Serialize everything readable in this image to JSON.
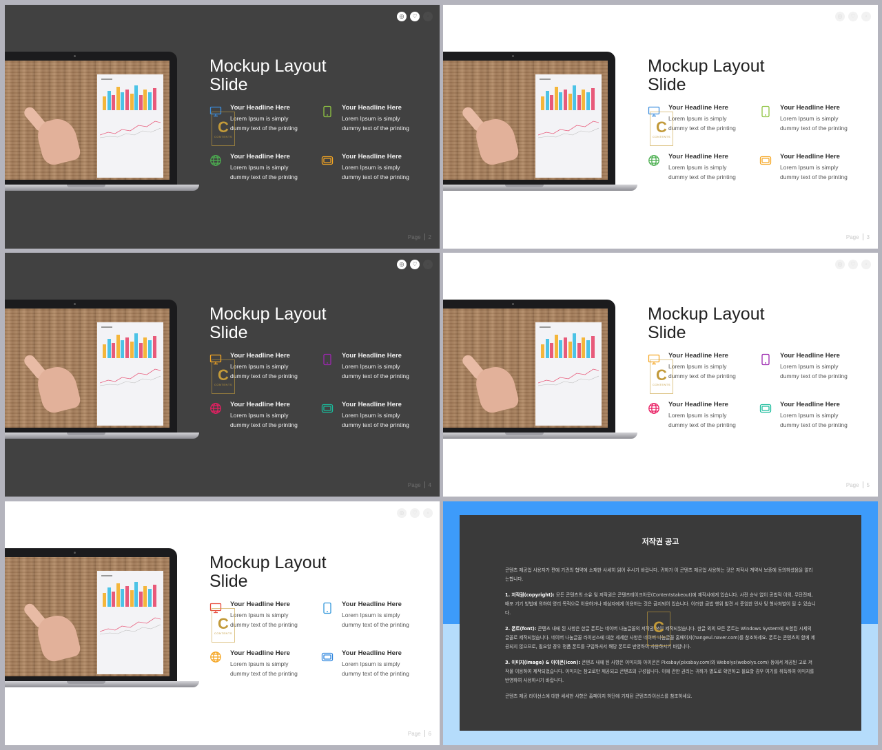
{
  "slides": [
    {
      "id": "2",
      "theme": "dark",
      "page_label": "Page",
      "page_number": "2",
      "title_line1": "Mockup Layout",
      "title_line2": "Slide",
      "icon_colors": [
        "#3c8ede",
        "#8fc442",
        "#4caf50",
        "#f5a623"
      ],
      "features": [
        {
          "headline": "Your Headline Here",
          "line1": "Lorem Ipsum is simply",
          "line2": "dummy text of the printing"
        },
        {
          "headline": "Your Headline Here",
          "line1": "Lorem Ipsum is simply",
          "line2": "dummy text of the printing"
        },
        {
          "headline": "Your Headline Here",
          "line1": "Lorem Ipsum is simply",
          "line2": "dummy text of the printing"
        },
        {
          "headline": "Your Headline Here",
          "line1": "Lorem Ipsum is simply",
          "line2": "dummy text of the printing"
        }
      ]
    },
    {
      "id": "3",
      "theme": "light",
      "page_label": "Page",
      "page_number": "3",
      "title_line1": "Mockup Layout",
      "title_line2": "Slide",
      "icon_colors": [
        "#3c8ede",
        "#8fc442",
        "#4caf50",
        "#f5a623"
      ],
      "features": [
        {
          "headline": "Your Headline Here",
          "line1": "Lorem Ipsum is simply",
          "line2": "dummy text of the printing"
        },
        {
          "headline": "Your Headline Here",
          "line1": "Lorem Ipsum is simply",
          "line2": "dummy text of the printing"
        },
        {
          "headline": "Your Headline Here",
          "line1": "Lorem Ipsum is simply",
          "line2": "dummy text of the printing"
        },
        {
          "headline": "Your Headline Here",
          "line1": "Lorem Ipsum is simply",
          "line2": "dummy text of the printing"
        }
      ]
    },
    {
      "id": "4",
      "theme": "dark",
      "page_label": "Page",
      "page_number": "4",
      "title_line1": "Mockup Layout",
      "title_line2": "Slide",
      "icon_colors": [
        "#f5a623",
        "#9b27af",
        "#e91e63",
        "#1abc9c"
      ],
      "features": [
        {
          "headline": "Your Headline Here",
          "line1": "Lorem Ipsum is simply",
          "line2": "dummy text of the printing"
        },
        {
          "headline": "Your Headline Here",
          "line1": "Lorem Ipsum is simply",
          "line2": "dummy text of the printing"
        },
        {
          "headline": "Your Headline Here",
          "line1": "Lorem Ipsum is simply",
          "line2": "dummy text of the printing"
        },
        {
          "headline": "Your Headline Here",
          "line1": "Lorem Ipsum is simply",
          "line2": "dummy text of the printing"
        }
      ]
    },
    {
      "id": "5",
      "theme": "light",
      "page_label": "Page",
      "page_number": "5",
      "title_line1": "Mockup Layout",
      "title_line2": "Slide",
      "icon_colors": [
        "#f5a623",
        "#9b27af",
        "#e91e63",
        "#1abc9c"
      ],
      "features": [
        {
          "headline": "Your Headline Here",
          "line1": "Lorem Ipsum is simply",
          "line2": "dummy text of the printing"
        },
        {
          "headline": "Your Headline Here",
          "line1": "Lorem Ipsum is simply",
          "line2": "dummy text of the printing"
        },
        {
          "headline": "Your Headline Here",
          "line1": "Lorem Ipsum is simply",
          "line2": "dummy text of the printing"
        },
        {
          "headline": "Your Headline Here",
          "line1": "Lorem Ipsum is simply",
          "line2": "dummy text of the printing"
        }
      ]
    },
    {
      "id": "6",
      "theme": "light",
      "page_label": "Page",
      "page_number": "6",
      "title_line1": "Mockup Layout",
      "title_line2": "Slide",
      "icon_colors": [
        "#e74c3c",
        "#3498db",
        "#f5a623",
        "#2e86de"
      ],
      "features": [
        {
          "headline": "Your Headline Here",
          "line1": "Lorem Ipsum is simply",
          "line2": "dummy text of the printing"
        },
        {
          "headline": "Your Headline Here",
          "line1": "Lorem Ipsum is simply",
          "line2": "dummy text of the printing"
        },
        {
          "headline": "Your Headline Here",
          "line1": "Lorem Ipsum is simply",
          "line2": "dummy text of the printing"
        },
        {
          "headline": "Your Headline Here",
          "line1": "Lorem Ipsum is simply",
          "line2": "dummy text of the printing"
        }
      ]
    }
  ],
  "watermark": {
    "letter": "C",
    "text": "CONTENTS"
  },
  "icon_names": [
    "monitor-icon",
    "tablet-icon",
    "globe-icon",
    "tv-icon"
  ],
  "top_icon_names": [
    "link-icon",
    "heart-icon",
    "share-icon"
  ],
  "copyright": {
    "title": "저작권 공고",
    "intro": "콘텐츠 제공업 사용자가 편에 기관의 협약에 소재한 사세히 읽어 주시기 바랍니다. 귀하가 이 콘텐츠 제공업 사용하는 것은 저작사 계약서 보증에 동의하셨음을 알리는합니다.",
    "s1_head": "1. 저작권(copyright):",
    "s1_body": "모든 콘텐츠의 소유 및 저작권은 콘텐츠테이크아웃(Contentstakeout)에 제작사에게 있습니다. 사전 승낙 없이 공법적 이외, 무단전재, 배포 기기 방법에 의하여 영리 목적으로 이용하거나 제삼자에게 이용하는 것은 금지되어 있습니다. 이러한 금법 행위 발견 시 준엄한 민사 및 형사처벌이 될 수 있습니다.",
    "s2_head": "2. 폰트(font):",
    "s2_body": "콘텐츠 내에 된 사항은 한글 폰트는 네이버 나눔글꼴의 저작권 쓰이 제작되었습니다. 한글 외의 모든 폰트는 Windows System에 포함된 시세의 글꼴로 제작되었습니다. 네이버 나눔글꼴 라이선스에 대한 세세한 사항은 네이버 나눔글꼴 홈페이지(hangeul.naver.com)를 참조하세요. 폰트는 콘텐츠의 함께 제공되지 않으므로, 필요할 경우 정품 폰트를 구입하셔서 해당 폰트로 반영하여 사용하시기 바랍니다.",
    "s3_head": "3. 이미지(image) & 아이콘(icon):",
    "s3_body": "콘텐츠 내에 된 사항은 이미지와 아이콘은 Pixabay(pixabay.com)와 Webolys(webolys.com) 등에서 제공된 고로 저작물 이용하여 제작되었습니다. 이미지는 참고로만 제공되고 콘텐츠의 구성됩니다. 이에 관한 권리는 귀하가 별도로 확인하고 필요할 경우 여기를 취득하여 이미지를 반영하여 사용하시기 바랍니다.",
    "outro": "콘텐츠 제공 라이선스에 대한 세세한 사항은 홈페이지 하단에 기재된 콘텐츠라이선스를 참조하세요."
  }
}
